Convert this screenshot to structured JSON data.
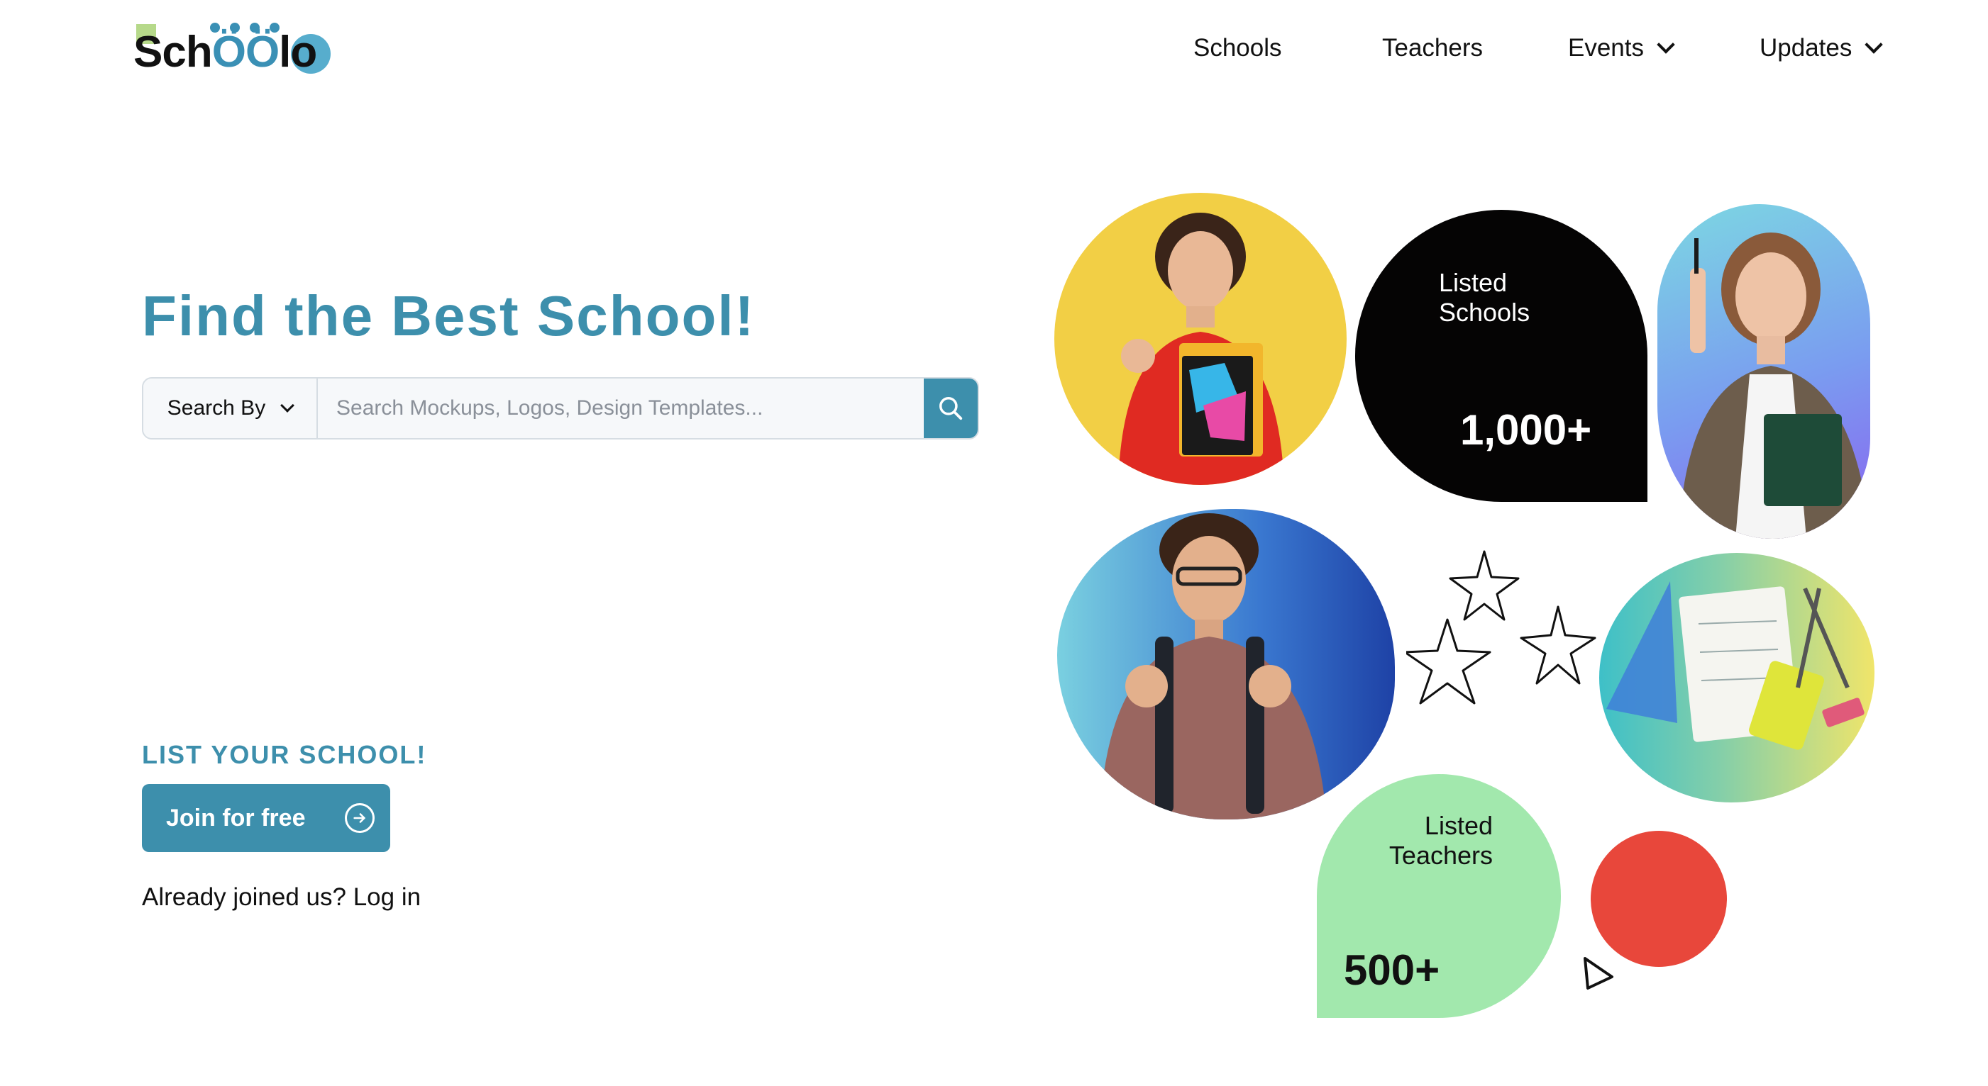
{
  "logo": {
    "text_start": "Sch",
    "text_mid": "ÖÖ",
    "text_end": "lo"
  },
  "nav": [
    {
      "label": "Schools",
      "has_dropdown": false
    },
    {
      "label": "Teachers",
      "has_dropdown": false
    },
    {
      "label": "Events",
      "has_dropdown": true
    },
    {
      "label": "Updates",
      "has_dropdown": true
    }
  ],
  "hero": {
    "title": "Find the Best School!",
    "search_by_label": "Search By",
    "search_placeholder": "Search Mockups, Logos, Design Templates...",
    "list_school": "LIST YOUR SCHOOL!",
    "join_label": "Join for free",
    "already_joined": "Already joined us?",
    "login_label": "Log in"
  },
  "stats": {
    "schools": {
      "label": "Listed\nSchools",
      "value": "1,000+"
    },
    "teachers": {
      "label": "Listed\nTeachers",
      "value": "500+"
    }
  },
  "colors": {
    "accent": "#3d8fac",
    "yellow": "#f2cf45",
    "black_blob": "#050404",
    "green_blob": "#a2e8ad",
    "red_dot": "#e8473b"
  },
  "images": {
    "student_female": "student-girl-thumbs-up-photo",
    "teacher": "teacher-with-pen-photo",
    "student_male": "student-boy-backpack-photo",
    "supplies": "school-supplies-photo"
  },
  "icons": [
    "search-icon",
    "chevron-down-icon",
    "arrow-right-circle-icon",
    "star-doodle-icon",
    "play-triangle-icon"
  ]
}
